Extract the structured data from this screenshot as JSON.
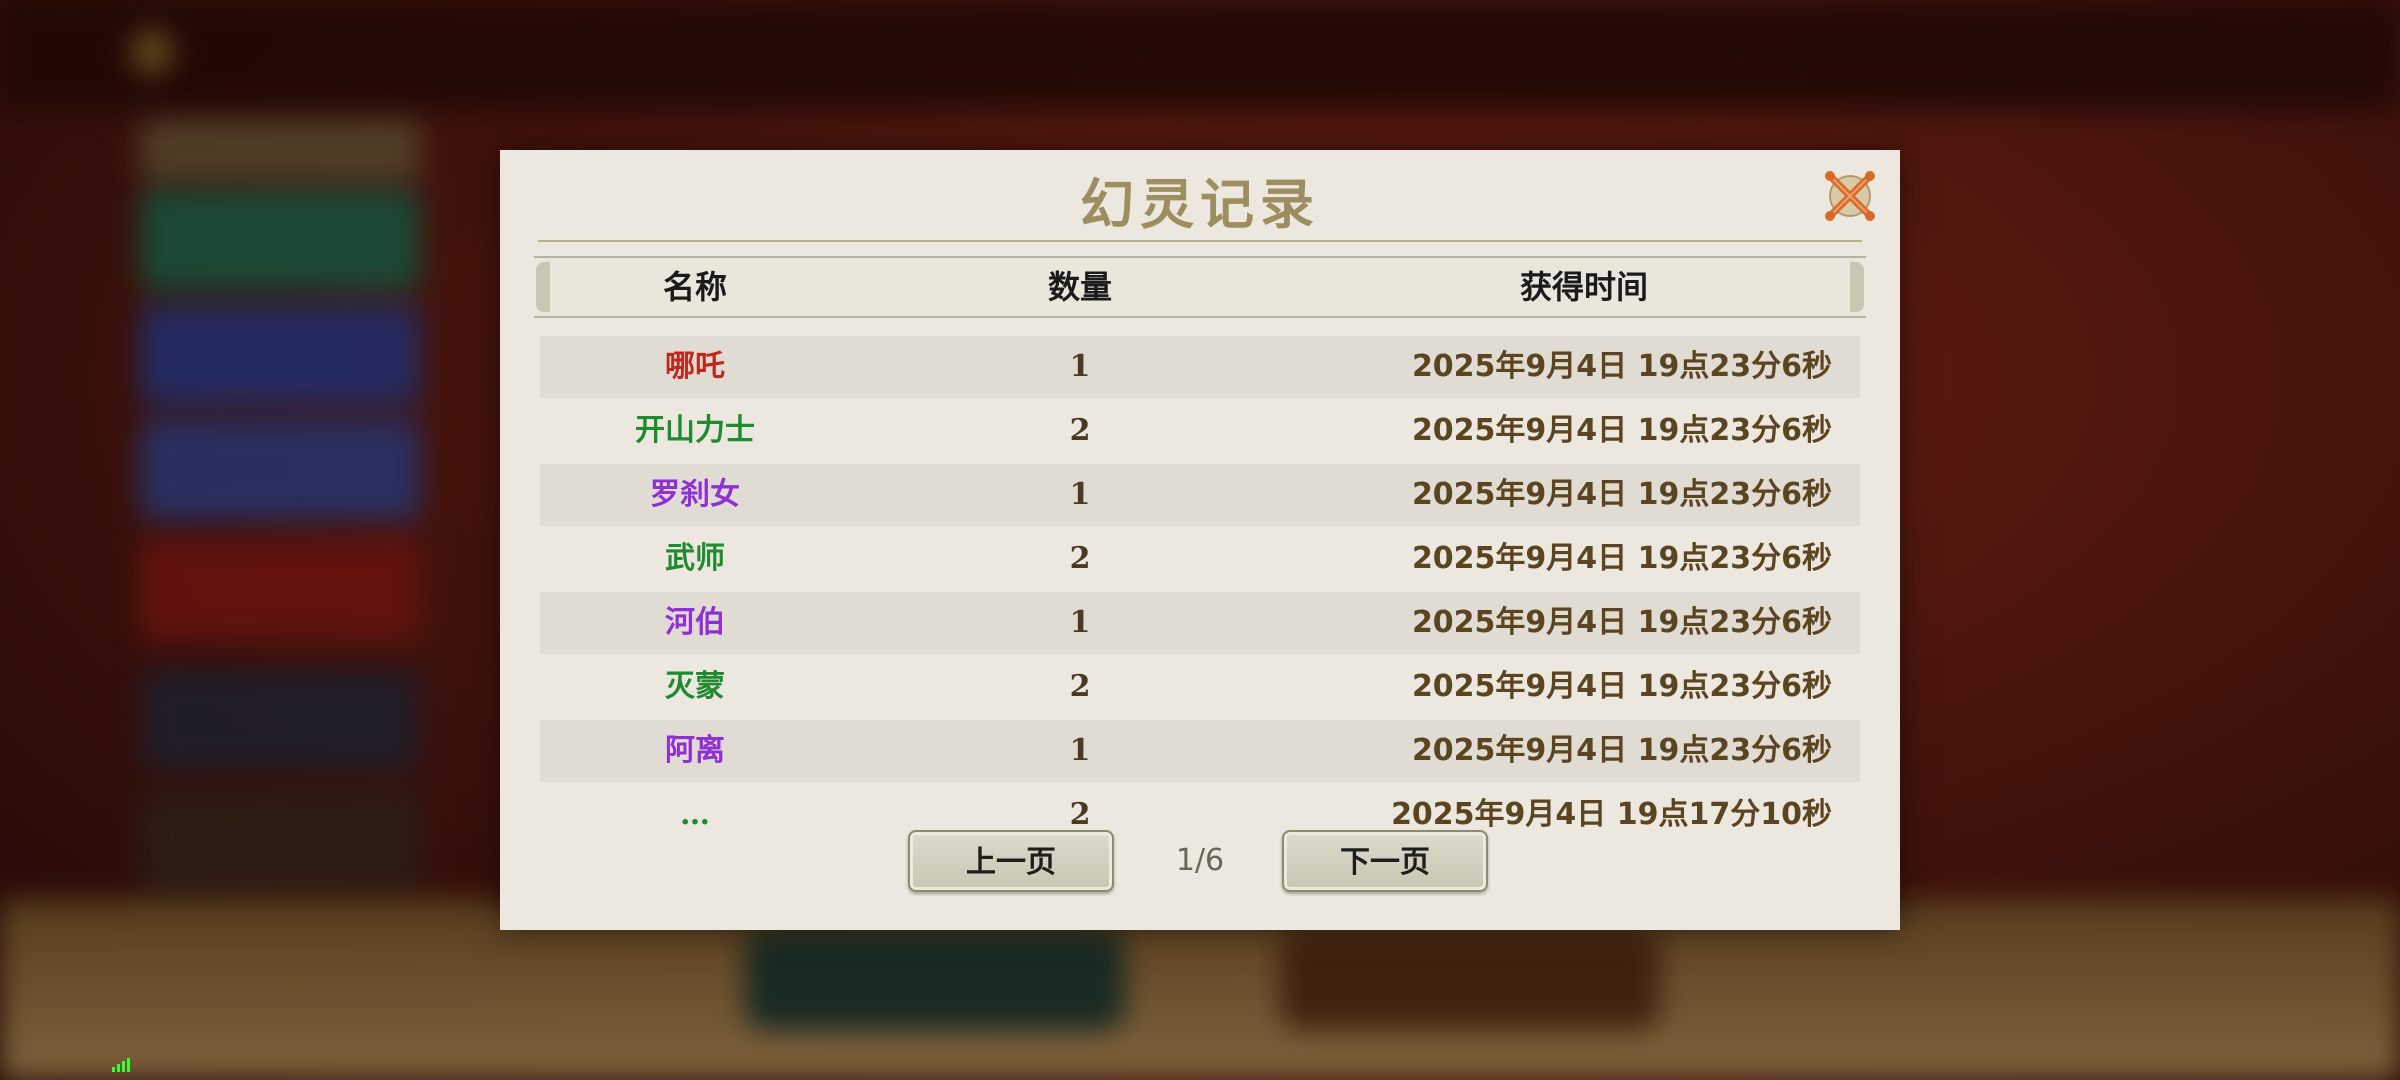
{
  "dialog": {
    "title": "幻灵记录",
    "close_icon": "close-x-icon",
    "headers": {
      "name": "名称",
      "qty": "数量",
      "time": "获得时间"
    },
    "rows": [
      {
        "name": "哪吒",
        "qty": "1",
        "time": "2025年9月4日  19点23分6秒",
        "quality": "red"
      },
      {
        "name": "开山力士",
        "qty": "2",
        "time": "2025年9月4日  19点23分6秒",
        "quality": "green"
      },
      {
        "name": "罗刹女",
        "qty": "1",
        "time": "2025年9月4日  19点23分6秒",
        "quality": "purple"
      },
      {
        "name": "武师",
        "qty": "2",
        "time": "2025年9月4日  19点23分6秒",
        "quality": "green"
      },
      {
        "name": "河伯",
        "qty": "1",
        "time": "2025年9月4日  19点23分6秒",
        "quality": "purple"
      },
      {
        "name": "灭蒙",
        "qty": "2",
        "time": "2025年9月4日  19点23分6秒",
        "quality": "green"
      },
      {
        "name": "阿离",
        "qty": "1",
        "time": "2025年9月4日  19点23分6秒",
        "quality": "purple"
      }
    ],
    "partial_row": {
      "name": "…",
      "qty": "2",
      "time": "2025年9月4日  19点17分10秒",
      "quality": "green"
    },
    "pager": {
      "prev_label": "上一页",
      "next_label": "下一页",
      "page": "1/6"
    }
  },
  "colors": {
    "red": "#c0281e",
    "green": "#1f8a2e",
    "purple": "#8f2fd6",
    "title": "#9c8e5e"
  }
}
